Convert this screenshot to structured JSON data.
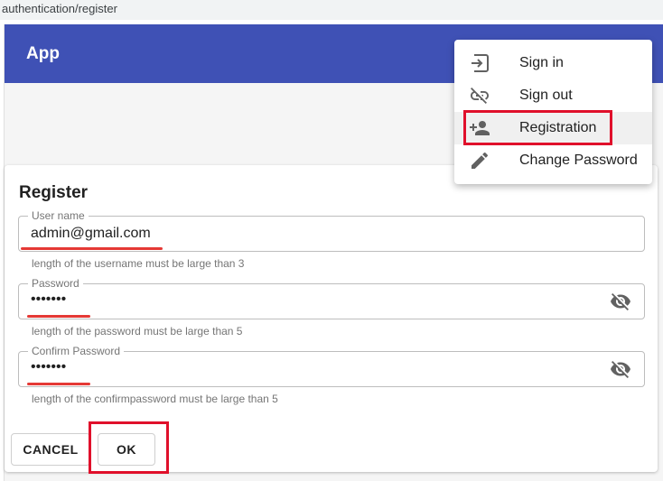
{
  "browser": {
    "url": "authentication/register"
  },
  "app": {
    "title": "App"
  },
  "menu": {
    "items": [
      {
        "label": "Sign in",
        "icon": "login-icon"
      },
      {
        "label": "Sign out",
        "icon": "link-off-icon"
      },
      {
        "label": "Registration",
        "icon": "person-add-icon",
        "highlighted": true
      },
      {
        "label": "Change Password",
        "icon": "edit-icon"
      }
    ]
  },
  "form": {
    "title": "Register",
    "username": {
      "label": "User name",
      "value": "admin@gmail.com",
      "hint": "length of the username must be large than 3"
    },
    "password": {
      "label": "Password",
      "value": "•••••••",
      "hint": "length of the password must be large than 5"
    },
    "confirm": {
      "label": "Confirm Password",
      "value": "•••••••",
      "hint": "length of the confirmpassword must be large than 5"
    },
    "cancel_label": "CANCEL",
    "ok_label": "OK"
  },
  "colors": {
    "appbar": "#3f51b5",
    "annotation": "#e0102b"
  }
}
